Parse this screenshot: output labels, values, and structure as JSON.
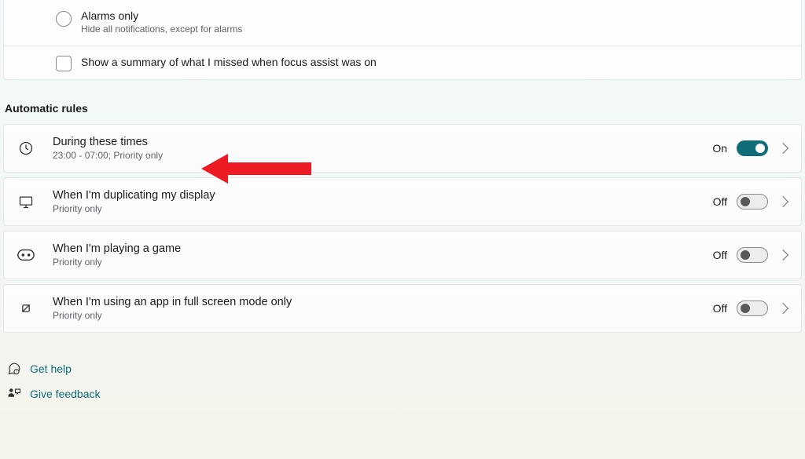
{
  "focusOptions": {
    "alarms": {
      "title": "Alarms only",
      "subtitle": "Hide all notifications, except for alarms"
    },
    "summary": {
      "label": "Show a summary of what I missed when focus assist was on"
    }
  },
  "sectionHeading": "Automatic rules",
  "rules": {
    "times": {
      "title": "During these times",
      "subtitle": "23:00 - 07:00; Priority only",
      "stateLabel": "On",
      "state": "on"
    },
    "display": {
      "title": "When I'm duplicating my display",
      "subtitle": "Priority only",
      "stateLabel": "Off",
      "state": "off"
    },
    "game": {
      "title": "When I'm playing a game",
      "subtitle": "Priority only",
      "stateLabel": "Off",
      "state": "off"
    },
    "fullscreen": {
      "title": "When I'm using an app in full screen mode only",
      "subtitle": "Priority only",
      "stateLabel": "Off",
      "state": "off"
    }
  },
  "footer": {
    "help": "Get help",
    "feedback": "Give feedback"
  }
}
